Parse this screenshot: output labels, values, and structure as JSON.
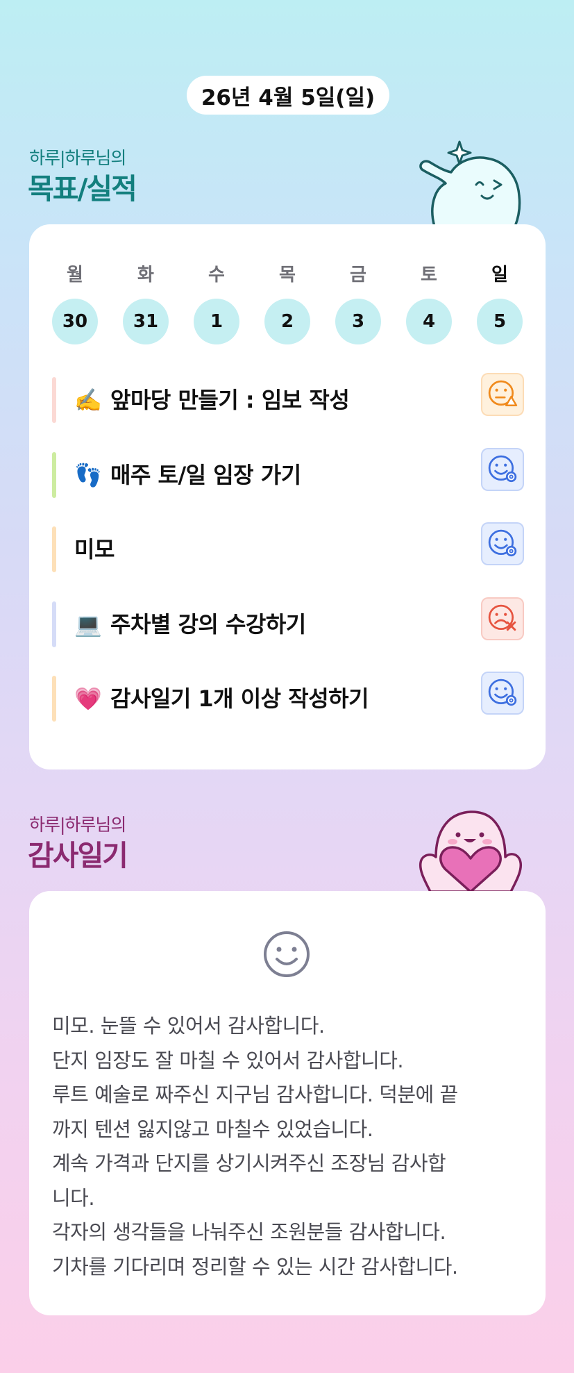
{
  "header": {
    "date": "26년 4월 5일(일)"
  },
  "goals_section": {
    "subtitle": "하루|하루님의",
    "title": "목표/실적"
  },
  "week": {
    "days": [
      {
        "label": "월",
        "num": "30"
      },
      {
        "label": "화",
        "num": "31"
      },
      {
        "label": "수",
        "num": "1"
      },
      {
        "label": "목",
        "num": "2"
      },
      {
        "label": "금",
        "num": "3"
      },
      {
        "label": "토",
        "num": "4"
      },
      {
        "label": "일",
        "num": "5"
      }
    ],
    "active_index": 6
  },
  "goals": [
    {
      "icon": "✍️",
      "text": "앞마당 만들기 : 임보 작성",
      "bar_color": "#fbd9d4",
      "mood": "warning-face-icon",
      "mood_color": "#f08a1c",
      "mood_bg": "#fff1dd"
    },
    {
      "icon": "👣",
      "text": "매주 토/일 임장 가기",
      "bar_color": "#cdeca0",
      "mood": "success-face-icon",
      "mood_color": "#3d6fe0",
      "mood_bg": "#e6eefe"
    },
    {
      "icon": "",
      "text": "미모",
      "bar_color": "#fde0b8",
      "mood": "success-face-icon",
      "mood_color": "#3d6fe0",
      "mood_bg": "#e6eefe"
    },
    {
      "icon": "💻",
      "text": "주차별 강의 수강하기",
      "bar_color": "#d5dcf7",
      "mood": "fail-face-icon",
      "mood_color": "#e6533f",
      "mood_bg": "#fde8e4"
    },
    {
      "icon": "💗",
      "text": "감사일기 1개 이상 작성하기",
      "bar_color": "#fde0b8",
      "mood": "success-face-icon",
      "mood_color": "#3d6fe0",
      "mood_bg": "#e6eefe"
    }
  ],
  "diary_section": {
    "subtitle": "하루|하루님의",
    "title": "감사일기"
  },
  "diary": {
    "mood_icon": "smile-face-icon",
    "lines": [
      "미모. 눈뜰 수 있어서 감사합니다.",
      "단지 임장도 잘 마칠 수 있어서 감사합니다.",
      "루트 예술로 짜주신 지구님 감사합니다. 덕분에 끝",
      "까지 텐션 잃지않고 마칠수 있었습니다.",
      "계속 가격과 단지를 상기시켜주신 조장님 감사합",
      "니다.",
      "각자의 생각들을 나눠주신 조원분들 감사합니다.",
      "기차를 기다리며 정리할 수 있는 시간 감사합니다."
    ]
  },
  "colors": {
    "teal": "#137f7e",
    "plum": "#8b2a70",
    "day_circle": "#c5eff2"
  }
}
